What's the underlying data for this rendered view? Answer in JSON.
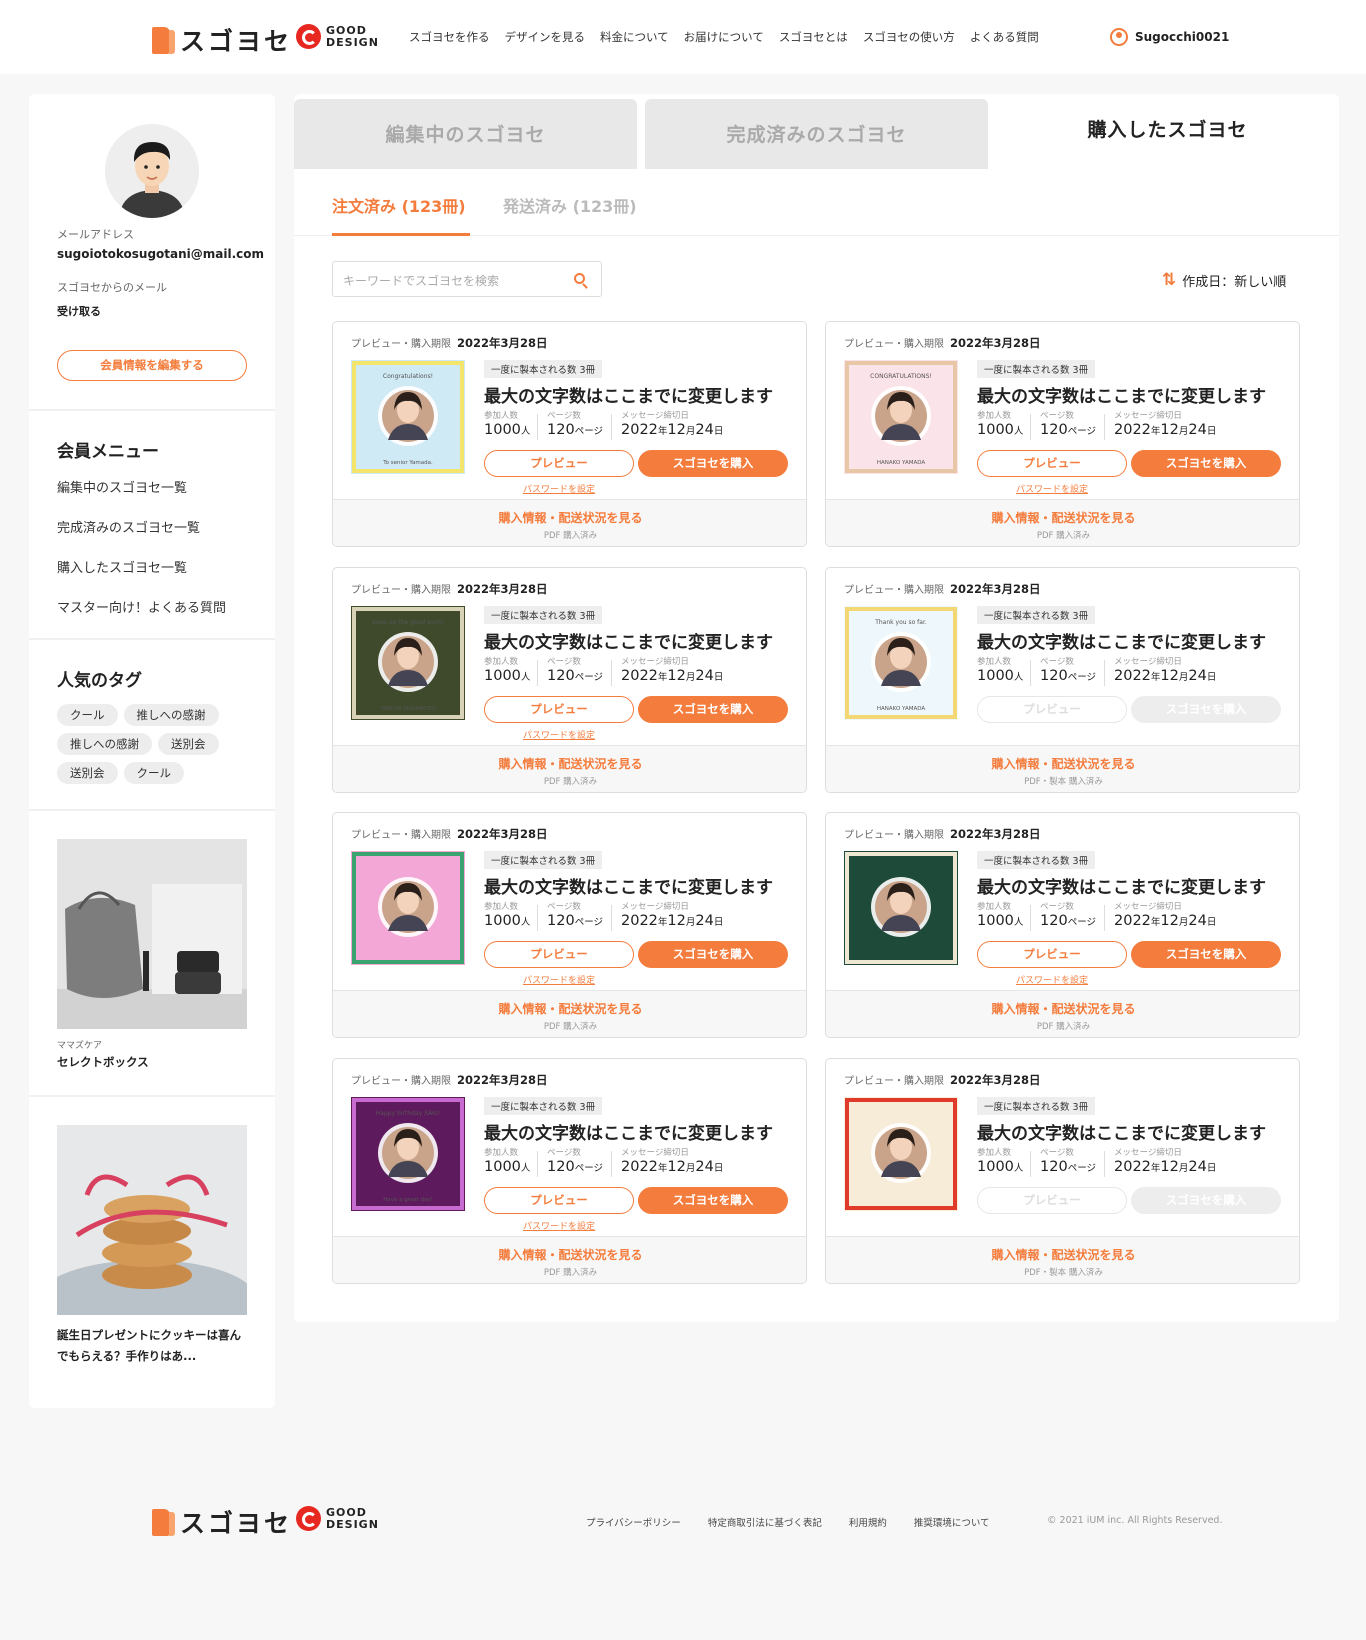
{
  "header": {
    "logo_text": "スゴヨセ",
    "gd_line1": "GOOD",
    "gd_line2": "DESIGN",
    "nav": [
      "スゴヨセを作る",
      "デザインを見る",
      "料金について",
      "お届けについて",
      "スゴヨセとは",
      "スゴヨセの使い方",
      "よくある質問"
    ],
    "username": "Sugocchi0021"
  },
  "sidebar": {
    "email_label": "メールアドレス",
    "email": "sugoiotokosugotani@mail.com",
    "mail_label": "スゴヨセからのメール",
    "mail_value": "受け取る",
    "edit_button": "会員情報を編集する",
    "menu_heading": "会員メニュー",
    "menu": [
      "編集中のスゴヨセ一覧",
      "完成済みのスゴヨセ一覧",
      "購入したスゴヨセ一覧",
      "マスター向け！よくある質問"
    ],
    "tags_heading": "人気のタグ",
    "tags": [
      "クール",
      "推しへの感謝",
      "推しへの感謝",
      "送別会",
      "送別会",
      "クール"
    ],
    "article1": {
      "category": "ママズケア",
      "title": "セレクトボックス"
    },
    "article2": {
      "title_line1": "誕生日プレゼントにクッキーは喜ん",
      "title_line2": "でもらえる？手作りはあ..."
    }
  },
  "tabs": [
    "編集中のスゴヨセ",
    "完成済みのスゴヨセ",
    "購入したスゴヨセ"
  ],
  "subtabs": [
    "注文済み (123冊)",
    "発送済み (123冊)"
  ],
  "search": {
    "placeholder": "キーワードでスゴヨセを検索"
  },
  "sort": {
    "label": "作成日：新しい順"
  },
  "card_common": {
    "deadline_label": "プレビュー・購入期限",
    "badge": "一度に製本される数 3冊",
    "title": "最大の文字数はここまでに変更します",
    "participants_label": "参加人数",
    "participants_value": "1000",
    "participants_unit": "人",
    "pages_label": "ページ数",
    "pages_value": "120",
    "pages_unit": "ページ",
    "msg_label": "メッセージ締切日",
    "msg_y": "2022",
    "msg_m": "12",
    "msg_d": "24",
    "preview_button": "プレビュー",
    "buy_button": "スゴヨセを購入",
    "password_link": "パスワードを設定",
    "footer_link": "購入情報・配送状況を見る"
  },
  "cards": [
    {
      "date": "2022年3月28日",
      "status": "PDF 購入済み",
      "thumb_text": "Congratulations!",
      "thumb_sub": "To senior Yamada.",
      "thumb_bg": "#cfe9f5",
      "frame": "#f3e56b"
    },
    {
      "date": "2022年3月28日",
      "status": "PDF 購入済み",
      "thumb_text": "CONGRATULATIONS!",
      "thumb_sub": "HANAKO YAMADA",
      "thumb_bg": "#fbe3ea",
      "frame": "#e7c7a6"
    },
    {
      "date": "2022年3月28日",
      "status": "PDF 購入済み",
      "thumb_text": "Keep up the good work!",
      "thumb_sub": "TAKUYA SUGAMOTO",
      "thumb_bg": "#3f4a2d",
      "frame": "#d8d2b6"
    },
    {
      "date": "2022年3月28日",
      "status": "PDF・製本 購入済み",
      "thumb_text": "Thank you so far.",
      "thumb_sub": "HANAKO YAMADA",
      "thumb_bg": "#eef7fb",
      "frame": "#f3d772"
    },
    {
      "date": "2022年3月28日",
      "status": "PDF 購入済み",
      "thumb_text": "",
      "thumb_sub": "",
      "thumb_bg": "#f3a7d6",
      "frame": "#3aa36f"
    },
    {
      "date": "2022年3月28日",
      "status": "PDF 購入済み",
      "thumb_text": "",
      "thumb_sub": "",
      "thumb_bg": "#1e4a3a",
      "frame": "#ede7d3"
    },
    {
      "date": "2022年3月28日",
      "status": "PDF 購入済み",
      "thumb_text": "Happy birthday SAKI!",
      "thumb_sub": "Have a great day!",
      "thumb_bg": "#5d1a5c",
      "frame": "#c86bd1"
    },
    {
      "date": "2022年3月28日",
      "status": "PDF・製本 購入済み",
      "thumb_text": "",
      "thumb_sub": "",
      "thumb_bg": "#f7ecd8",
      "frame": "#e03a2a"
    }
  ],
  "footer": {
    "links": [
      "プライバシーポリシー",
      "特定商取引法に基づく表記",
      "利用規約",
      "推奨環境について"
    ],
    "copyright": "© 2021 iUM inc. All Rights Reserved."
  },
  "colors": {
    "accent": "#f47c3c",
    "background": "#f7f7f7",
    "panel": "#ffffff"
  }
}
